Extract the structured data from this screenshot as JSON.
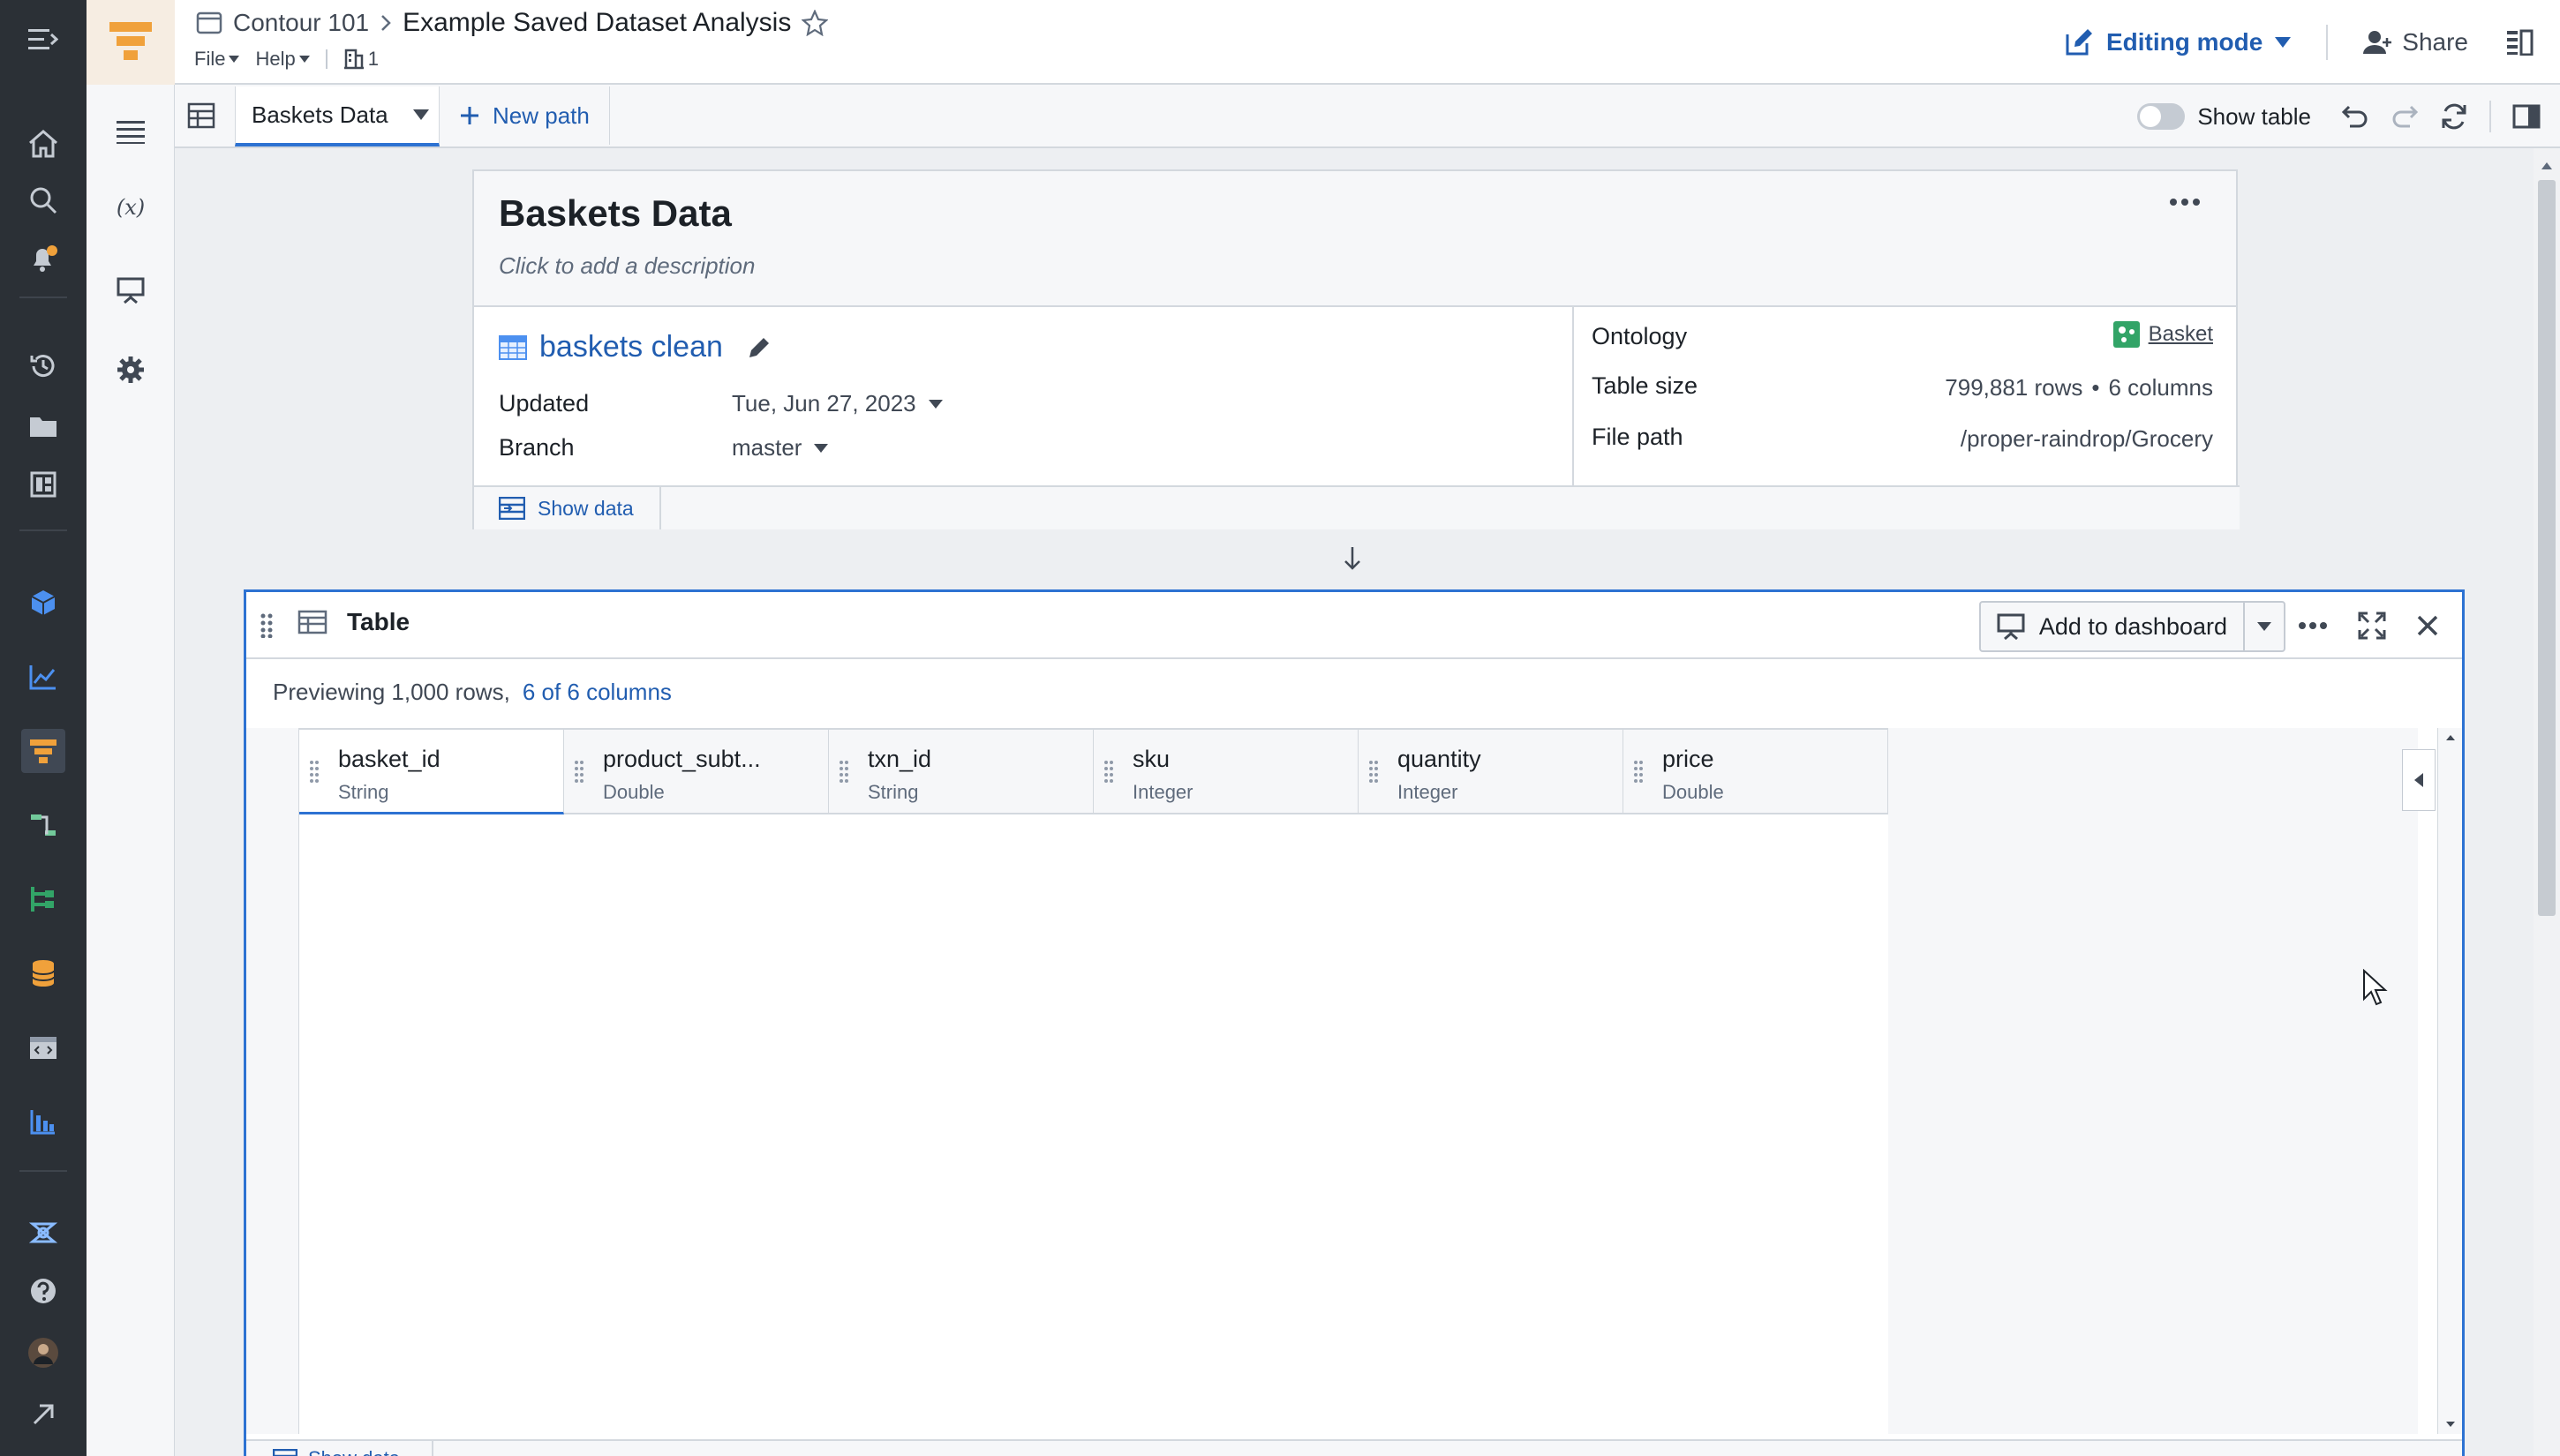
{
  "header": {
    "breadcrumb_parent": "Contour 101",
    "title": "Example Saved Dataset Analysis",
    "menus": [
      "File",
      "Help"
    ],
    "viewers_count": "1",
    "editing_mode_label": "Editing mode",
    "share_label": "Share"
  },
  "tabs": {
    "active_tab_label": "Baskets Data",
    "new_path_label": "New path",
    "show_table_label": "Show table",
    "show_table_on": false
  },
  "dataset_card": {
    "title": "Baskets Data",
    "description_placeholder": "Click to add a description",
    "dataset_name": "baskets clean",
    "updated_label": "Updated",
    "updated_value": "Tue, Jun 27, 2023",
    "branch_label": "Branch",
    "branch_value": "master",
    "ontology_label": "Ontology",
    "ontology_value": "Basket",
    "table_size_label": "Table size",
    "table_size_rows": "799,881 rows",
    "table_size_cols": "6 columns",
    "file_path_label": "File path",
    "file_path_value": "/proper-raindrop/Grocery",
    "show_data_label": "Show data"
  },
  "table_board": {
    "title": "Table",
    "add_to_dashboard_label": "Add to dashboard",
    "preview_text": "Previewing 1,000 rows,",
    "columns_link": "6 of 6 columns",
    "columns": [
      {
        "name": "basket_id",
        "type": "String"
      },
      {
        "name": "product_subt...",
        "type": "Double"
      },
      {
        "name": "txn_id",
        "type": "String"
      },
      {
        "name": "sku",
        "type": "Integer"
      },
      {
        "name": "quantity",
        "type": "Integer"
      },
      {
        "name": "price",
        "type": "Double"
      }
    ],
    "footer_show_data_label": "Show data"
  },
  "colors": {
    "accent": "#2d72d2",
    "link": "#215db0",
    "rail": "#2b3036"
  },
  "icons": {
    "rail": [
      "collapse-menu-icon",
      "home-icon",
      "search-icon",
      "notifications-icon",
      "history-icon",
      "folder-icon",
      "dashboard-icon",
      "cube-icon",
      "chart-icon",
      "contour-icon",
      "pipeline-icon",
      "branch-icon",
      "database-icon",
      "code-icon",
      "bar-chart-icon",
      "ontology-icon",
      "help-icon",
      "user-avatar",
      "external-link-icon"
    ],
    "side": [
      "list-icon",
      "variables-icon",
      "presentation-icon",
      "settings-icon"
    ]
  }
}
